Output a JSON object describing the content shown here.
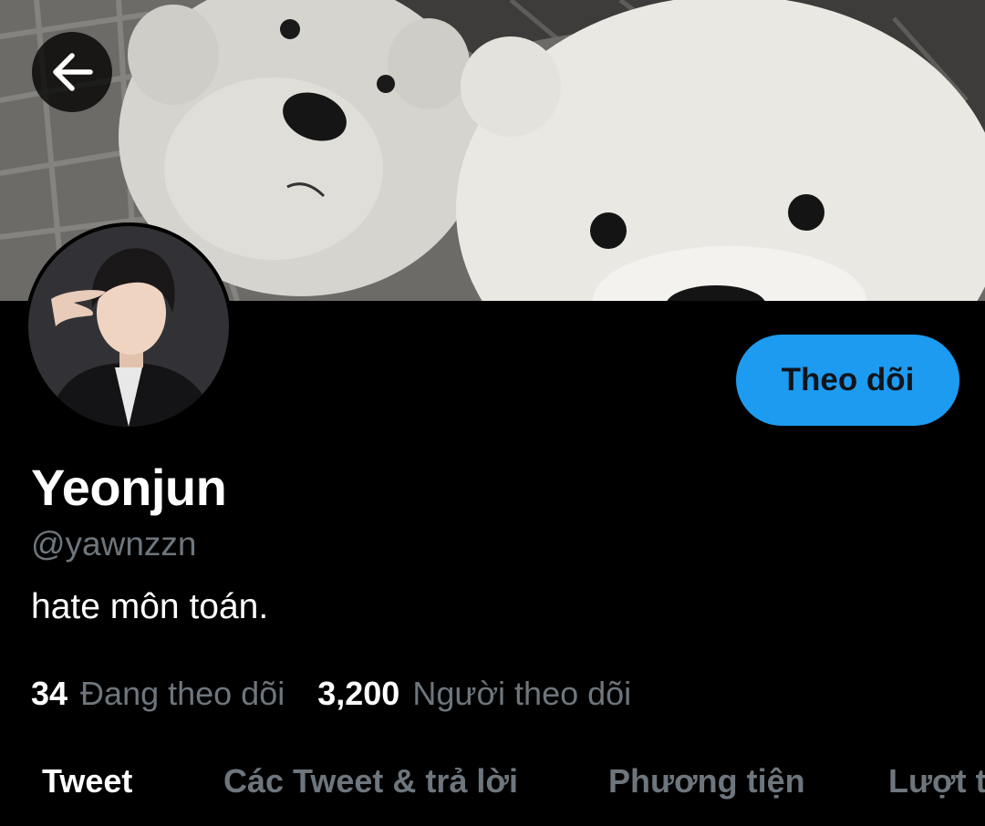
{
  "header": {
    "back_icon": "arrow-left-icon"
  },
  "profile": {
    "display_name": "Yeonjun",
    "handle": "@yawnzzn",
    "bio": "hate môn toán.",
    "follow_label": "Theo dõi",
    "following_count": "34",
    "following_label": "Đang theo dõi",
    "followers_count": "3,200",
    "followers_label": "Người theo dõi"
  },
  "tabs": [
    {
      "label": "Tweet",
      "active": true
    },
    {
      "label": "Các Tweet & trả lời",
      "active": false
    },
    {
      "label": "Phương tiện",
      "active": false
    },
    {
      "label": "Lượt thích",
      "active": false
    }
  ],
  "colors": {
    "background": "#000000",
    "accent": "#1d9bf0",
    "secondary_text": "#6e767d",
    "primary_text": "#ffffff"
  }
}
